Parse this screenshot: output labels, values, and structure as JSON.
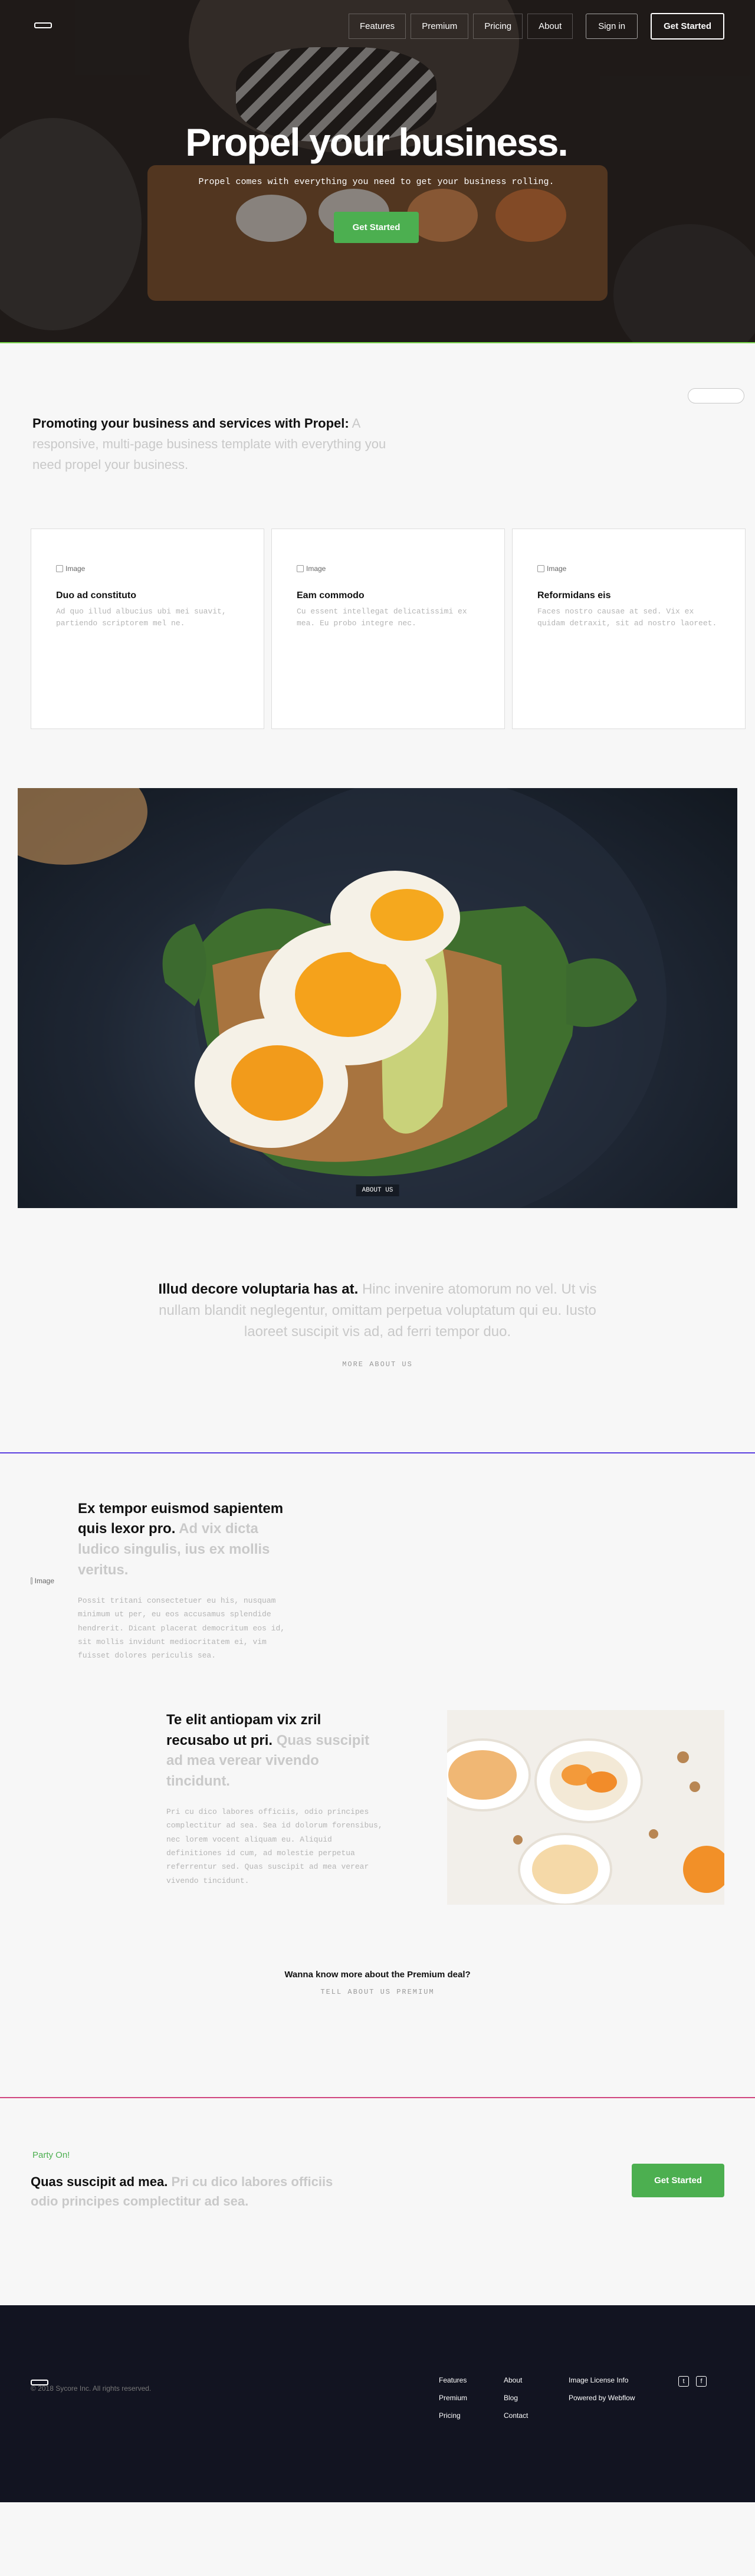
{
  "nav": {
    "logo_icon": "logo-icon",
    "links": [
      "Features",
      "Premium",
      "Pricing",
      "About"
    ],
    "sign_in": "Sign in",
    "get_started": "Get Started"
  },
  "hero": {
    "title": "Propel your business.",
    "subtitle": "Propel comes with everything you need to get your business rolling.",
    "button": "Get Started"
  },
  "features": {
    "intro_bold": "Promoting your business and services with Propel:",
    "intro_light": "A responsive, multi-page business template with everything you need propel your business.",
    "cards": [
      {
        "img": "Image",
        "title": "Duo ad constituto",
        "text": "Ad quo illud albucius ubi mei suavit, partiendo scriptorem mel ne."
      },
      {
        "img": "Image",
        "title": "Eam commodo",
        "text": "Cu essent intellegat delicatissimi ex mea. Eu probo integre nec."
      },
      {
        "img": "Image",
        "title": "Reformidans eis",
        "text": "Faces nostro causae at sed. Vix ex quidam detraxit, sit ad nostro laoreet."
      }
    ]
  },
  "food": {
    "badge": "ABOUT US"
  },
  "about": {
    "bold": "Illud decore voluptaria has at.",
    "light": "Hinc invenire atomorum no vel. Ut vis nullam blandit neglegentur, omittam perpetua voluptatum qui eu. Iusto laoreet suscipit vis ad, ad ferri tempor duo.",
    "link": "MORE ABOUT US"
  },
  "premium": {
    "img": "Image",
    "block1_bold": "Ex tempor euismod sapientem quis lexor pro.",
    "block1_light": "Ad vix dicta ludico singulis, ius ex mollis veritus.",
    "block1_text": "Possit tritani consectetuer eu his, nusquam minimum ut per, eu eos accusamus splendide hendrerit. Dicant placerat democritum eos id, sit mollis invidunt mediocritatem ei, vim fuisset dolores periculis sea.",
    "block2_bold": "Te elit antiopam vix zril recusabo ut pri.",
    "block2_light": "Quas suscipit ad mea verear vivendo tincidunt.",
    "block2_text": "Pri cu dico labores officiis, odio principes complectitur ad sea. Sea id dolorum forensibus, nec lorem vocent aliquam eu. Aliquid definitiones id cum, ad molestie perpetua referrentur sed. Quas suscipit ad mea verear vivendo tincidunt.",
    "cta_question": "Wanna know more about the Premium deal?",
    "cta_link": "TELL ABOUT US PREMIUM"
  },
  "party": {
    "kicker": "Party On!",
    "bold": "Quas suscipit ad mea.",
    "light": "Pri cu dico labores officiis odio principes complectitur ad sea.",
    "button": "Get Started"
  },
  "footer": {
    "copyright": "© 2018 Sycore Inc. All rights reserved.",
    "col1": [
      "Features",
      "Premium",
      "Pricing"
    ],
    "col2": [
      "About",
      "Blog",
      "Contact"
    ],
    "col3": [
      "Image License Info",
      "Powered by Webflow"
    ],
    "social_icons": [
      "twitter-icon",
      "facebook-icon"
    ]
  },
  "colors": {
    "accent": "#4caf50",
    "footer_bg": "#121421"
  }
}
